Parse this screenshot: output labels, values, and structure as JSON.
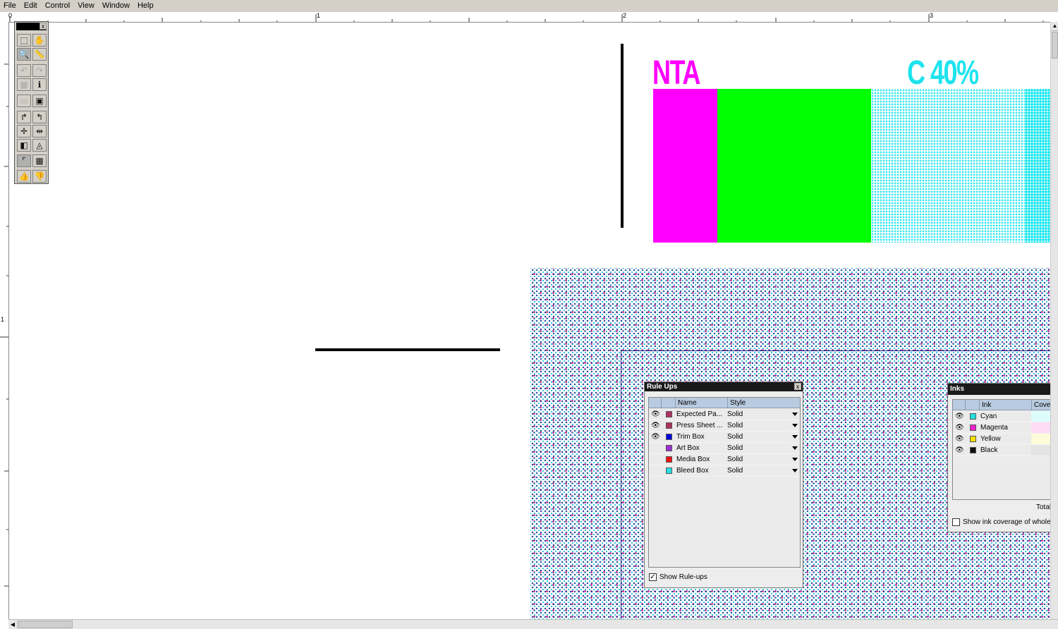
{
  "menu": {
    "items": [
      {
        "label": "File"
      },
      {
        "label": "Edit"
      },
      {
        "label": "Control"
      },
      {
        "label": "View"
      },
      {
        "label": "Window"
      },
      {
        "label": "Help"
      }
    ]
  },
  "ruler": {
    "horizontal_labels": [
      "0",
      "1",
      "2",
      "3"
    ],
    "vertical_labels": [
      "1"
    ]
  },
  "toolbox": {
    "close_label": "x",
    "tools": [
      {
        "icon": "marquee-select-icon",
        "glyph": "⬚"
      },
      {
        "icon": "hand-pan-icon",
        "glyph": "✋"
      },
      {
        "icon": "zoom-magnifier-icon",
        "glyph": "🔍"
      },
      {
        "icon": "measure-ruler-icon",
        "glyph": "📏"
      },
      {
        "icon": "undo-disabled-icon",
        "glyph": "↶"
      },
      {
        "icon": "redo-disabled-icon",
        "glyph": "↷"
      },
      {
        "icon": "object-select-disabled-icon",
        "glyph": "▦"
      },
      {
        "icon": "object-info-icon",
        "glyph": "ℹ"
      },
      {
        "icon": "print-disabled-icon",
        "glyph": "▭"
      },
      {
        "icon": "page-view-icon",
        "glyph": "▣"
      },
      {
        "icon": "rotate-right-icon",
        "glyph": "↱"
      },
      {
        "icon": "rotate-left-icon",
        "glyph": "↰"
      },
      {
        "icon": "move-vertical-icon",
        "glyph": "✛"
      },
      {
        "icon": "move-horizontal-icon",
        "glyph": "⇹"
      },
      {
        "icon": "separation-preview-icon",
        "glyph": "◧"
      },
      {
        "icon": "ink-dropper-icon",
        "glyph": "◬"
      },
      {
        "icon": "box-corner-icon",
        "glyph": "⌜"
      },
      {
        "icon": "grid-icon",
        "glyph": "▦"
      },
      {
        "icon": "thumbs-up-icon",
        "glyph": "👍"
      },
      {
        "icon": "thumbs-down-icon",
        "glyph": "👎"
      }
    ]
  },
  "artwork": {
    "label_nta": "NTA",
    "label_c40": "C 40%",
    "colors": {
      "magenta": "#ff00ff",
      "green": "#00ff00",
      "cyan": "#00e5ee",
      "halftone_blue": "#2a4a9a"
    }
  },
  "rule_ups": {
    "title": "Rule Ups",
    "close_label": "x",
    "columns": [
      "Name",
      "Style"
    ],
    "rows": [
      {
        "name": "Expected Pa...",
        "style": "Solid",
        "color": "#b03060",
        "visible": true
      },
      {
        "name": "Press Sheet ...",
        "style": "Solid",
        "color": "#b03060",
        "visible": true
      },
      {
        "name": "Trim Box",
        "style": "Solid",
        "color": "#0000dd",
        "visible": true
      },
      {
        "name": "Art Box",
        "style": "Solid",
        "color": "#9b30d0",
        "visible": false
      },
      {
        "name": "Media Box",
        "style": "Solid",
        "color": "#ee1111",
        "visible": false
      },
      {
        "name": "Bleed Box",
        "style": "Solid",
        "color": "#22e0e0",
        "visible": false
      }
    ],
    "show_label": "Show Rule-ups",
    "show_checked": true
  },
  "inks": {
    "title": "Inks",
    "columns": [
      "Ink",
      "Covers"
    ],
    "rows": [
      {
        "name": "Cyan",
        "color": "#22e0e0",
        "cover": "-",
        "cover_bg": "#dffcfc"
      },
      {
        "name": "Magenta",
        "color": "#ee22cc",
        "cover": "-",
        "cover_bg": "#fddcf6"
      },
      {
        "name": "Yellow",
        "color": "#f2e000",
        "cover": "-",
        "cover_bg": "#fdfbd8"
      },
      {
        "name": "Black",
        "color": "#111111",
        "cover": "-",
        "cover_bg": "#e4e4e4"
      }
    ],
    "total_label": "Total:",
    "show_label": "Show ink coverage of whole pa",
    "show_checked": false
  }
}
